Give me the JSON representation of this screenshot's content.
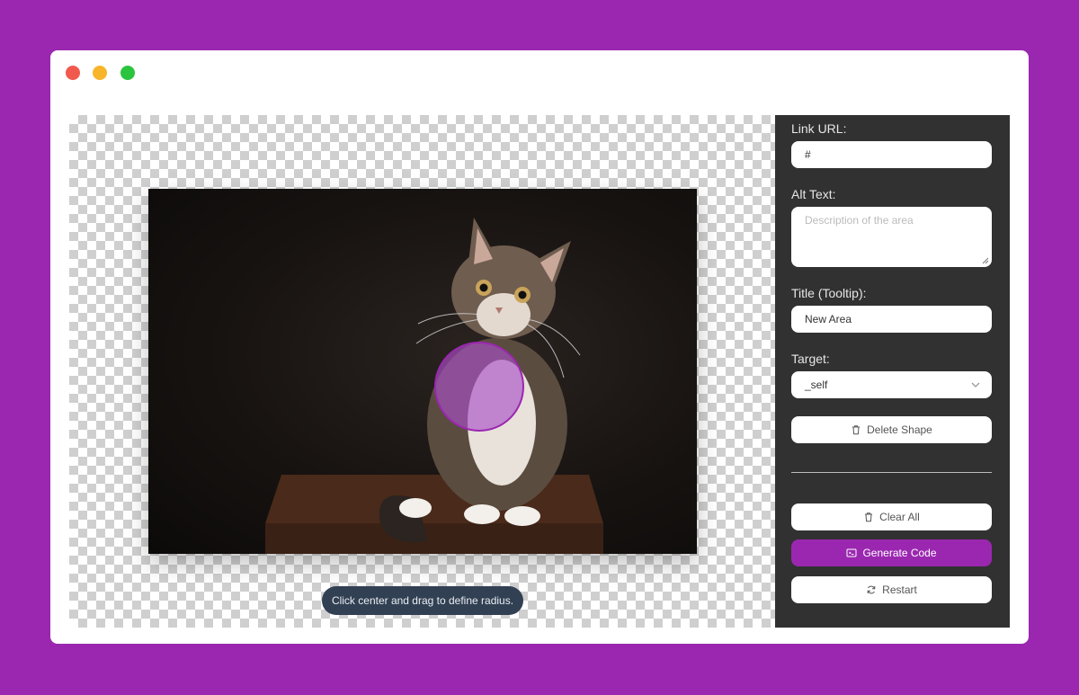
{
  "window": {
    "controls": [
      "close",
      "minimize",
      "maximize"
    ]
  },
  "canvas": {
    "hint": "Click center and drag to define radius."
  },
  "panel": {
    "link_url": {
      "label": "Link URL:",
      "value": "#"
    },
    "alt_text": {
      "label": "Alt Text:",
      "placeholder": "Description of the area"
    },
    "title": {
      "label": "Title (Tooltip):",
      "value": "New Area"
    },
    "target": {
      "label": "Target:",
      "value": "_self"
    },
    "delete_label": "Delete Shape",
    "clear_label": "Clear All",
    "generate_label": "Generate Code",
    "restart_label": "Restart"
  },
  "colors": {
    "accent": "#9b27b0",
    "panel_bg": "#313131",
    "hint_bg": "#324053"
  },
  "icons": {
    "delete": "trash-icon",
    "clear": "trash-icon",
    "generate": "code-icon",
    "restart": "refresh-icon",
    "target": "chevron-down-icon"
  }
}
